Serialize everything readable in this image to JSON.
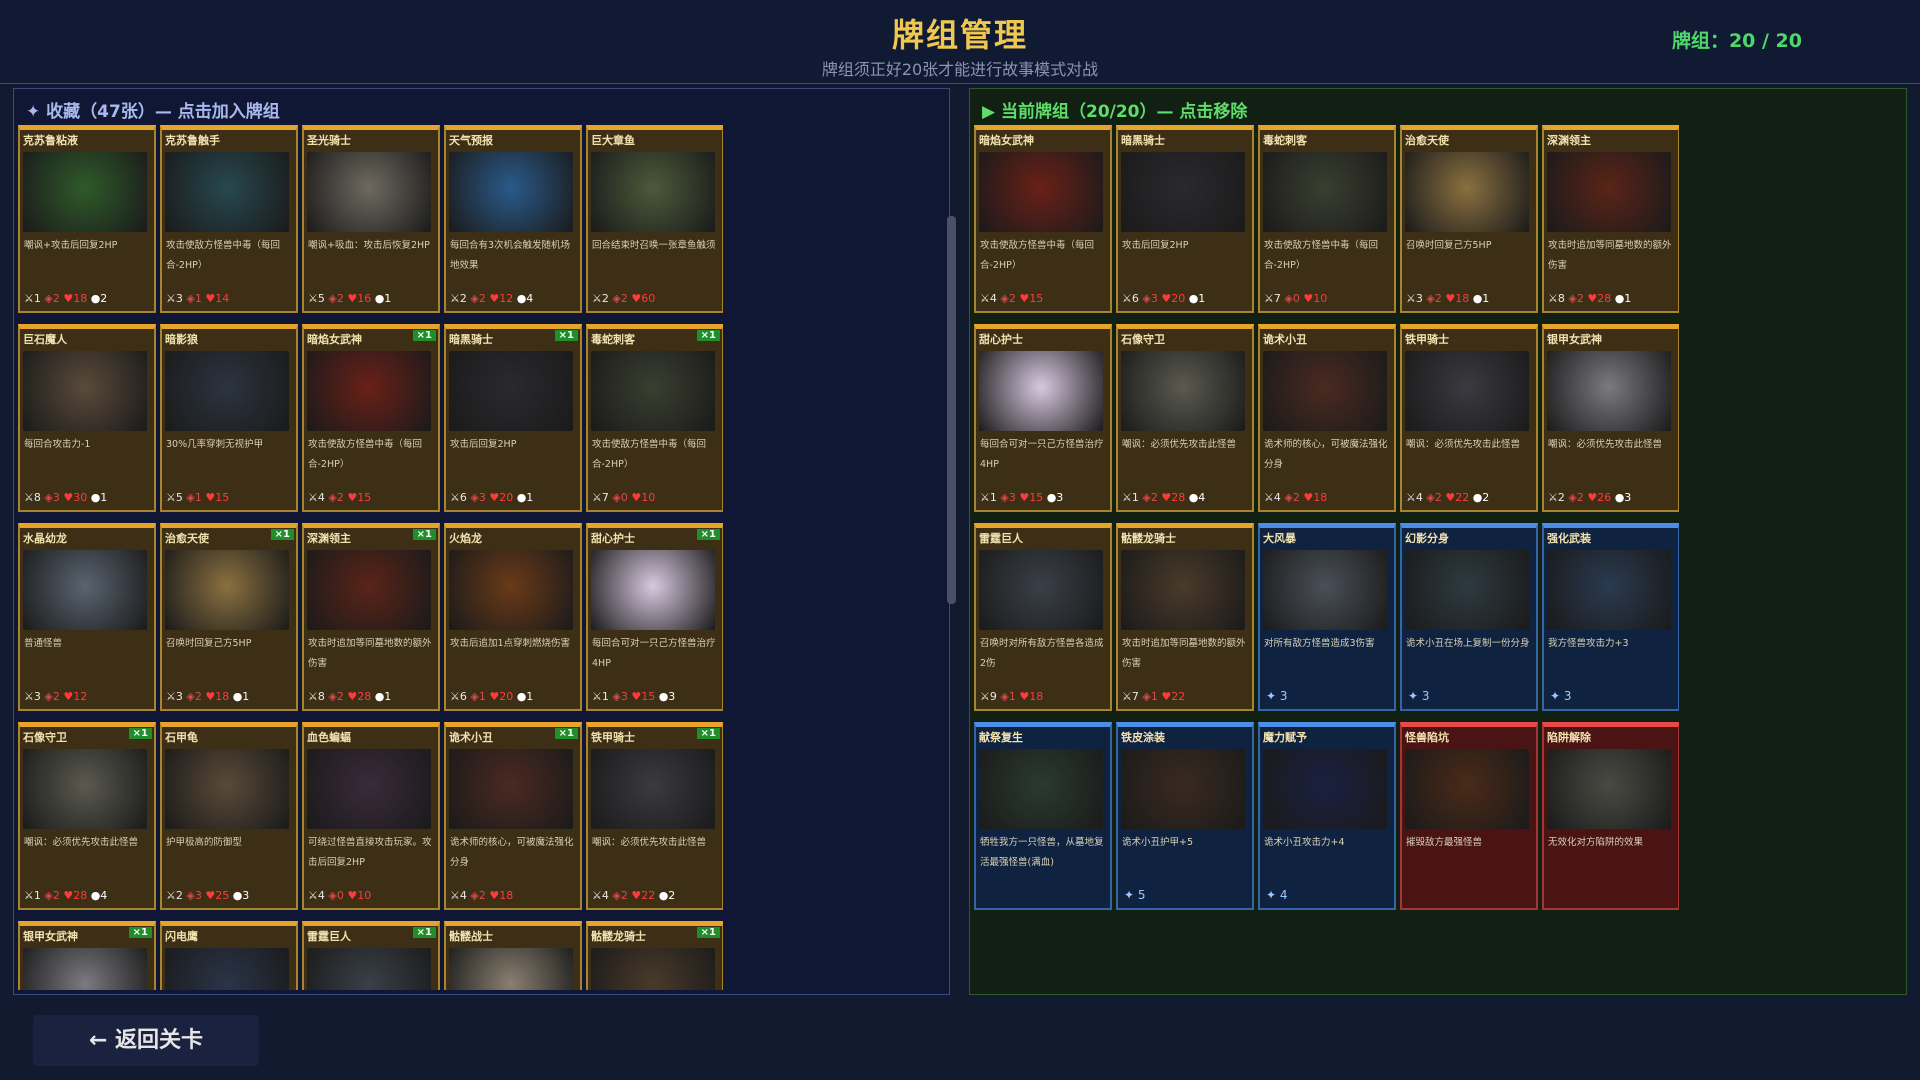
{
  "header": {
    "title": "牌组管理",
    "subtitle": "牌组须正好20张才能进行故事模式对战",
    "count": "牌组：20 / 20"
  },
  "collection": {
    "title": "✦ 收藏（47张）— 点击加入牌组",
    "cards": [
      {
        "name": "克苏鲁粘液",
        "desc": "嘲讽+攻击后回复2HP",
        "atk": "1",
        "def": "2",
        "hp": "18",
        "cost": "2",
        "badge": "",
        "type": "monster",
        "art": "#2f5a2a"
      },
      {
        "name": "克苏鲁触手",
        "desc": "攻击使敌方怪兽中毒（每回合-2HP）",
        "atk": "3",
        "def": "1",
        "hp": "14",
        "cost": "",
        "badge": "",
        "type": "monster",
        "art": "#27484f"
      },
      {
        "name": "圣光骑士",
        "desc": "嘲讽+吸血：攻击后恢复2HP",
        "atk": "5",
        "def": "2",
        "hp": "16",
        "cost": "1",
        "badge": "",
        "type": "monster",
        "art": "#6e6a60"
      },
      {
        "name": "天气预报",
        "desc": "每回合有3次机会触发随机场地效果",
        "atk": "2",
        "def": "2",
        "hp": "12",
        "cost": "4",
        "badge": "",
        "type": "monster",
        "art": "#2a5a8a"
      },
      {
        "name": "巨大章鱼",
        "desc": "回合结束时召唤一张章鱼触须",
        "atk": "2",
        "def": "2",
        "hp": "60",
        "cost": "",
        "badge": "",
        "type": "monster",
        "art": "#4c5a3a"
      },
      {
        "name": "巨石魔人",
        "desc": "每回合攻击力-1",
        "atk": "8",
        "def": "3",
        "hp": "30",
        "cost": "1",
        "badge": "",
        "type": "monster",
        "art": "#5a4a3a"
      },
      {
        "name": "暗影狼",
        "desc": "30%几率穿刺无视护甲",
        "atk": "5",
        "def": "1",
        "hp": "15",
        "cost": "",
        "badge": "",
        "type": "monster",
        "art": "#2c3440"
      },
      {
        "name": "暗焰女武神",
        "desc": "攻击使敌方怪兽中毒（每回合-2HP）",
        "atk": "4",
        "def": "2",
        "hp": "15",
        "cost": "",
        "badge": "×1",
        "type": "monster",
        "art": "#6a2018"
      },
      {
        "name": "暗黑骑士",
        "desc": "攻击后回复2HP",
        "atk": "6",
        "def": "3",
        "hp": "20",
        "cost": "1",
        "badge": "×1",
        "type": "monster",
        "art": "#2a2a2e"
      },
      {
        "name": "毒蛇刺客",
        "desc": "攻击使敌方怪兽中毒（每回合-2HP）",
        "atk": "7",
        "def": "0",
        "hp": "10",
        "cost": "",
        "badge": "×1",
        "type": "monster",
        "art": "#3a3f30"
      },
      {
        "name": "水晶幼龙",
        "desc": "普通怪兽",
        "atk": "3",
        "def": "2",
        "hp": "12",
        "cost": "",
        "badge": "",
        "type": "monster",
        "art": "#5a6470"
      },
      {
        "name": "治愈天使",
        "desc": "召唤时回复己方5HP",
        "atk": "3",
        "def": "2",
        "hp": "18",
        "cost": "1",
        "badge": "×1",
        "type": "monster",
        "art": "#8a7040"
      },
      {
        "name": "深渊领主",
        "desc": "攻击时追加等同墓地数的额外伤害",
        "atk": "8",
        "def": "2",
        "hp": "28",
        "cost": "1",
        "badge": "×1",
        "type": "monster",
        "art": "#5a2418"
      },
      {
        "name": "火焰龙",
        "desc": "攻击后追加1点穿刺燃烧伤害",
        "atk": "6",
        "def": "1",
        "hp": "20",
        "cost": "1",
        "badge": "",
        "type": "monster",
        "art": "#6a3a18"
      },
      {
        "name": "甜心护士",
        "desc": "每回合可对一只己方怪兽治疗4HP",
        "atk": "1",
        "def": "3",
        "hp": "15",
        "cost": "3",
        "badge": "×1",
        "type": "monster",
        "art": "#d8c8e0"
      },
      {
        "name": "石像守卫",
        "desc": "嘲讽：必须优先攻击此怪兽",
        "atk": "1",
        "def": "2",
        "hp": "28",
        "cost": "4",
        "badge": "×1",
        "type": "monster",
        "art": "#5a5a50"
      },
      {
        "name": "石甲龟",
        "desc": "护甲极高的防御型",
        "atk": "2",
        "def": "3",
        "hp": "25",
        "cost": "3",
        "badge": "",
        "type": "monster",
        "art": "#5a4a38"
      },
      {
        "name": "血色蝙蝠",
        "desc": "可绕过怪兽直接攻击玩家。攻击后回复2HP",
        "atk": "4",
        "def": "0",
        "hp": "10",
        "cost": "",
        "badge": "",
        "type": "monster",
        "art": "#3a2a3a"
      },
      {
        "name": "诡术小丑",
        "desc": "诡术师的核心，可被魔法强化分身",
        "atk": "4",
        "def": "2",
        "hp": "18",
        "cost": "",
        "badge": "×1",
        "type": "monster",
        "art": "#4a2a20"
      },
      {
        "name": "铁甲骑士",
        "desc": "嘲讽：必须优先攻击此怪兽",
        "atk": "4",
        "def": "2",
        "hp": "22",
        "cost": "2",
        "badge": "×1",
        "type": "monster",
        "art": "#3a3a40"
      },
      {
        "name": "银甲女武神",
        "desc": "",
        "atk": "",
        "def": "",
        "hp": "",
        "cost": "",
        "badge": "×1",
        "type": "monster",
        "art": "#7a7a80"
      },
      {
        "name": "闪电鹰",
        "desc": "",
        "atk": "",
        "def": "",
        "hp": "",
        "cost": "",
        "badge": "",
        "type": "monster",
        "art": "#2a3448"
      },
      {
        "name": "雷霆巨人",
        "desc": "",
        "atk": "",
        "def": "",
        "hp": "",
        "cost": "",
        "badge": "×1",
        "type": "monster",
        "art": "#3a4048"
      },
      {
        "name": "骷髅战士",
        "desc": "",
        "atk": "",
        "def": "",
        "hp": "",
        "cost": "",
        "badge": "",
        "type": "monster",
        "art": "#8a8070"
      },
      {
        "name": "骷髅龙骑士",
        "desc": "",
        "atk": "",
        "def": "",
        "hp": "",
        "cost": "",
        "badge": "×1",
        "type": "monster",
        "art": "#4a3a2a"
      }
    ]
  },
  "deck": {
    "title": "▶ 当前牌组（20/20）— 点击移除",
    "cards": [
      {
        "name": "暗焰女武神",
        "desc": "攻击使敌方怪兽中毒（每回合-2HP）",
        "atk": "4",
        "def": "2",
        "hp": "15",
        "cost": "",
        "type": "monster",
        "art": "#6a2018"
      },
      {
        "name": "暗黑骑士",
        "desc": "攻击后回复2HP",
        "atk": "6",
        "def": "3",
        "hp": "20",
        "cost": "1",
        "type": "monster",
        "art": "#2a2a2e"
      },
      {
        "name": "毒蛇刺客",
        "desc": "攻击使敌方怪兽中毒（每回合-2HP）",
        "atk": "7",
        "def": "0",
        "hp": "10",
        "cost": "",
        "type": "monster",
        "art": "#3a3f30"
      },
      {
        "name": "治愈天使",
        "desc": "召唤时回复己方5HP",
        "atk": "3",
        "def": "2",
        "hp": "18",
        "cost": "1",
        "type": "monster",
        "art": "#8a7040"
      },
      {
        "name": "深渊领主",
        "desc": "攻击时追加等同墓地数的额外伤害",
        "atk": "8",
        "def": "2",
        "hp": "28",
        "cost": "1",
        "type": "monster",
        "art": "#5a2418"
      },
      {
        "name": "甜心护士",
        "desc": "每回合可对一只己方怪兽治疗4HP",
        "atk": "1",
        "def": "3",
        "hp": "15",
        "cost": "3",
        "type": "monster",
        "art": "#d8c8e0"
      },
      {
        "name": "石像守卫",
        "desc": "嘲讽：必须优先攻击此怪兽",
        "atk": "1",
        "def": "2",
        "hp": "28",
        "cost": "4",
        "type": "monster",
        "art": "#5a5a50"
      },
      {
        "name": "诡术小丑",
        "desc": "诡术师的核心，可被魔法强化分身",
        "atk": "4",
        "def": "2",
        "hp": "18",
        "cost": "",
        "type": "monster",
        "art": "#4a2a20"
      },
      {
        "name": "铁甲骑士",
        "desc": "嘲讽：必须优先攻击此怪兽",
        "atk": "4",
        "def": "2",
        "hp": "22",
        "cost": "2",
        "type": "monster",
        "art": "#3a3a40"
      },
      {
        "name": "银甲女武神",
        "desc": "嘲讽：必须优先攻击此怪兽",
        "atk": "2",
        "def": "2",
        "hp": "26",
        "cost": "3",
        "type": "monster",
        "art": "#7a7a80"
      },
      {
        "name": "雷霆巨人",
        "desc": "召唤时对所有敌方怪兽各造成2伤",
        "atk": "9",
        "def": "1",
        "hp": "18",
        "cost": "",
        "type": "monster",
        "art": "#3a4048"
      },
      {
        "name": "骷髅龙骑士",
        "desc": "攻击时追加等同墓地数的额外伤害",
        "atk": "7",
        "def": "1",
        "hp": "22",
        "cost": "",
        "type": "monster",
        "art": "#4a3a2a"
      },
      {
        "name": "大风暴",
        "desc": "对所有敌方怪兽造成3伤害",
        "spellcost": "✦ 3",
        "type": "spell",
        "art": "#4a5058"
      },
      {
        "name": "幻影分身",
        "desc": "诡术小丑在场上复制一份分身",
        "spellcost": "✦ 3",
        "type": "spell",
        "art": "#2e3a40"
      },
      {
        "name": "强化武装",
        "desc": "我方怪兽攻击力+3",
        "spellcost": "✦ 3",
        "type": "spell",
        "art": "#2a3a50"
      },
      {
        "name": "献祭复生",
        "desc": "牺牲我方一只怪兽，从墓地复活最强怪兽(满血)",
        "spellcost": "",
        "type": "spell",
        "art": "#2a3a30"
      },
      {
        "name": "铁皮涂装",
        "desc": "诡术小丑护甲+5",
        "spellcost": "✦ 5",
        "type": "spell",
        "art": "#3a2a20"
      },
      {
        "name": "魔力赋予",
        "desc": "诡术小丑攻击力+4",
        "spellcost": "✦ 4",
        "type": "spell",
        "art": "#1a2040"
      },
      {
        "name": "怪兽陷坑",
        "desc": "摧毁敌方最强怪兽",
        "spellcost": "",
        "type": "trap",
        "art": "#4a2a18"
      },
      {
        "name": "陷阱解除",
        "desc": "无效化对方陷阱的效果",
        "spellcost": "",
        "type": "trap",
        "art": "#4a4a44"
      }
    ]
  },
  "footer": {
    "back_label": "← 返回关卡"
  }
}
